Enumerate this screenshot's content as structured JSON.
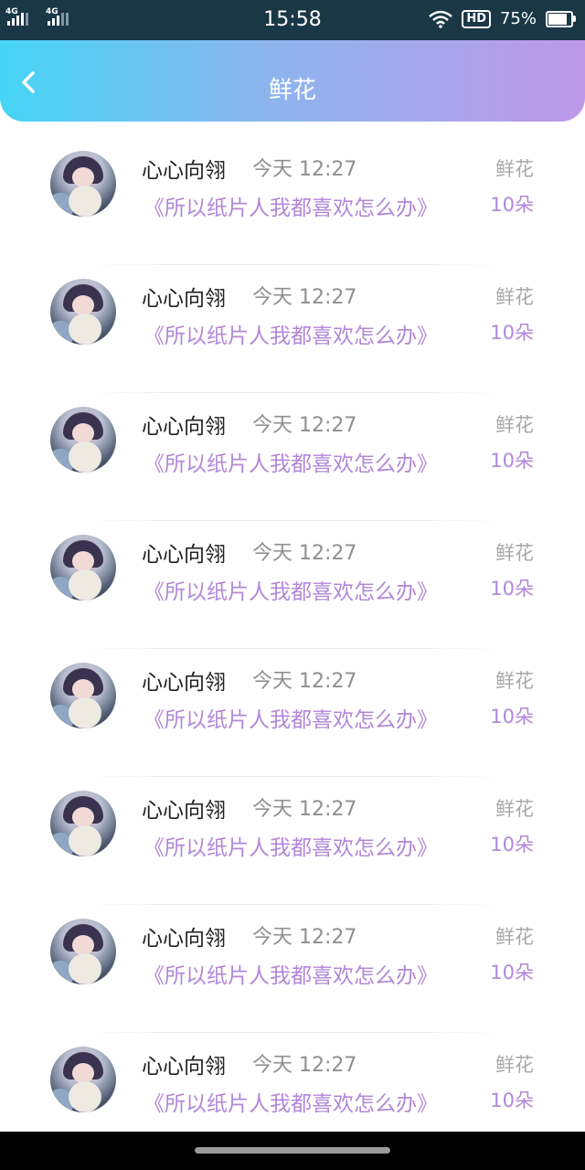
{
  "status_bar": {
    "signal_1_label": "4G",
    "signal_2_label": "4G",
    "time": "15:58",
    "hd_label": "HD",
    "battery_text": "75%",
    "battery_level": 0.75
  },
  "header": {
    "title": "鲜花",
    "back_icon": "chevron-left-icon",
    "gradient": [
      "#45d5f5",
      "#bf98ea"
    ]
  },
  "colors": {
    "accent": "#b287d8",
    "muted": "#a8a8a8"
  },
  "records": [
    {
      "username": "心心向翎",
      "time": "今天 12:27",
      "message": "《所以纸片人我都喜欢怎么办》",
      "gift_name": "鲜花",
      "gift_count": "10朵"
    },
    {
      "username": "心心向翎",
      "time": "今天 12:27",
      "message": "《所以纸片人我都喜欢怎么办》",
      "gift_name": "鲜花",
      "gift_count": "10朵"
    },
    {
      "username": "心心向翎",
      "time": "今天 12:27",
      "message": "《所以纸片人我都喜欢怎么办》",
      "gift_name": "鲜花",
      "gift_count": "10朵"
    },
    {
      "username": "心心向翎",
      "time": "今天 12:27",
      "message": "《所以纸片人我都喜欢怎么办》",
      "gift_name": "鲜花",
      "gift_count": "10朵"
    },
    {
      "username": "心心向翎",
      "time": "今天 12:27",
      "message": "《所以纸片人我都喜欢怎么办》",
      "gift_name": "鲜花",
      "gift_count": "10朵"
    },
    {
      "username": "心心向翎",
      "time": "今天 12:27",
      "message": "《所以纸片人我都喜欢怎么办》",
      "gift_name": "鲜花",
      "gift_count": "10朵"
    },
    {
      "username": "心心向翎",
      "time": "今天 12:27",
      "message": "《所以纸片人我都喜欢怎么办》",
      "gift_name": "鲜花",
      "gift_count": "10朵"
    },
    {
      "username": "心心向翎",
      "time": "今天 12:27",
      "message": "《所以纸片人我都喜欢怎么办》",
      "gift_name": "鲜花",
      "gift_count": "10朵"
    }
  ]
}
